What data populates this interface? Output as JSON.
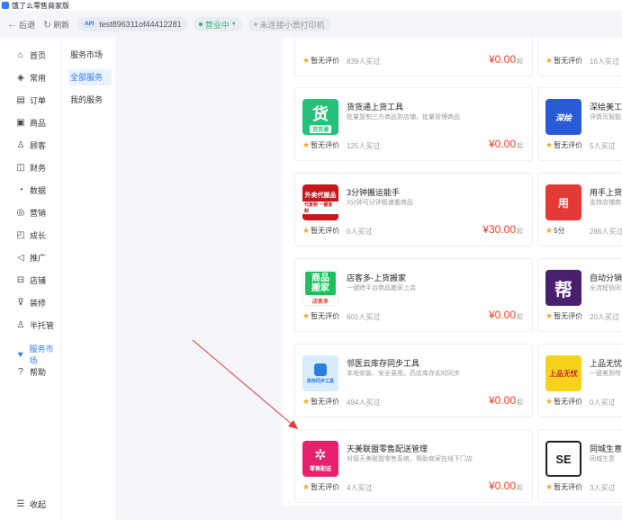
{
  "window": {
    "title": "饿了么零售商家版"
  },
  "toolbar": {
    "back_label": "后退",
    "refresh_label": "刷新",
    "store_api_badge": "API",
    "store_name": "test896311of44412281",
    "status_label": "营业中",
    "printer_label": "未连接小票打印机"
  },
  "nav": {
    "items": [
      {
        "label": "首页",
        "icon": "home-icon"
      },
      {
        "label": "常用",
        "icon": "layers-icon"
      },
      {
        "label": "订单",
        "icon": "order-icon"
      },
      {
        "label": "商品",
        "icon": "goods-icon"
      },
      {
        "label": "顾客",
        "icon": "customer-icon"
      },
      {
        "label": "财务",
        "icon": "finance-icon"
      },
      {
        "label": "数据",
        "icon": "chart-icon"
      },
      {
        "label": "营销",
        "icon": "marketing-icon"
      },
      {
        "label": "成长",
        "icon": "growth-icon"
      },
      {
        "label": "推广",
        "icon": "promote-icon"
      },
      {
        "label": "店铺",
        "icon": "store-icon"
      },
      {
        "label": "装修",
        "icon": "decorate-icon"
      },
      {
        "label": "半托管",
        "icon": "hosting-icon"
      },
      {
        "label": "服务市场",
        "icon": "heart-icon"
      },
      {
        "label": "帮助",
        "icon": "help-icon"
      }
    ],
    "collapse_label": "收起"
  },
  "subnav": {
    "title": "服务市场",
    "items": [
      "全部服务",
      "我的服务"
    ]
  },
  "cards_left": [
    {
      "name": "",
      "desc": "",
      "rating": "暂无评价",
      "sold": "839人买过",
      "price": "¥0.00",
      "unit": "起"
    },
    {
      "name": "货货通上货工具",
      "desc": "批量复制三方商品到店铺，批量管理商品",
      "rating": "暂无评价",
      "sold": "125人买过",
      "price": "¥0.00",
      "unit": "起",
      "icon_text": "货",
      "icon_sub": "货货通"
    },
    {
      "name": "3分钟搬运能手",
      "desc": "3分钟可分钟极速搬商品",
      "rating": "暂无评价",
      "sold": "0人买过",
      "price": "¥30.00",
      "unit": "起",
      "icon_text": "外卖代搬品",
      "icon_sub": "代复制 一键复制"
    },
    {
      "name": "店客多-上货搬家",
      "desc": "一键跨平台商品搬家上店",
      "rating": "暂无评价",
      "sold": "601人买过",
      "price": "¥0.00",
      "unit": "起",
      "icon_text": "商品搬家",
      "icon_sub": "店客多"
    },
    {
      "name": "邻医云库存同步工具",
      "desc": "本地安装、安全易用，药店库存实时同步",
      "rating": "暂无评价",
      "sold": "494人买过",
      "price": "¥0.00",
      "unit": "起",
      "icon_text": "库存同步工具"
    },
    {
      "name": "天美联盟零售配送管理",
      "desc": "对接天美联盟零售系统，帮助商家在线下门店",
      "rating": "暂无评价",
      "sold": "4人买过",
      "price": "¥0.00",
      "unit": "起",
      "icon_text": "零售配送"
    }
  ],
  "cards_right": [
    {
      "name": "",
      "desc": "",
      "rating": "暂无评价",
      "sold": "16人买过"
    },
    {
      "name": "深绘美工",
      "desc": "详情页智能",
      "rating": "暂无评价",
      "sold": "5人买过",
      "icon_text": "深绘"
    },
    {
      "name": "用手上货",
      "desc": "支持店铺商",
      "rating": "5分",
      "sold": "286人买过",
      "icon_text": "用"
    },
    {
      "name": "自动分销",
      "desc": "全流程协同",
      "rating": "暂无评价",
      "sold": "20人买过",
      "icon_text": "帮"
    },
    {
      "name": "上品无忧",
      "desc": "一键美到传",
      "rating": "暂无评价",
      "sold": "0人买过",
      "icon_text": "上品无忧"
    },
    {
      "name": "同城生意",
      "desc": "同城生意",
      "rating": "暂无评价",
      "sold": "3人买过",
      "icon_text": "SE"
    }
  ]
}
